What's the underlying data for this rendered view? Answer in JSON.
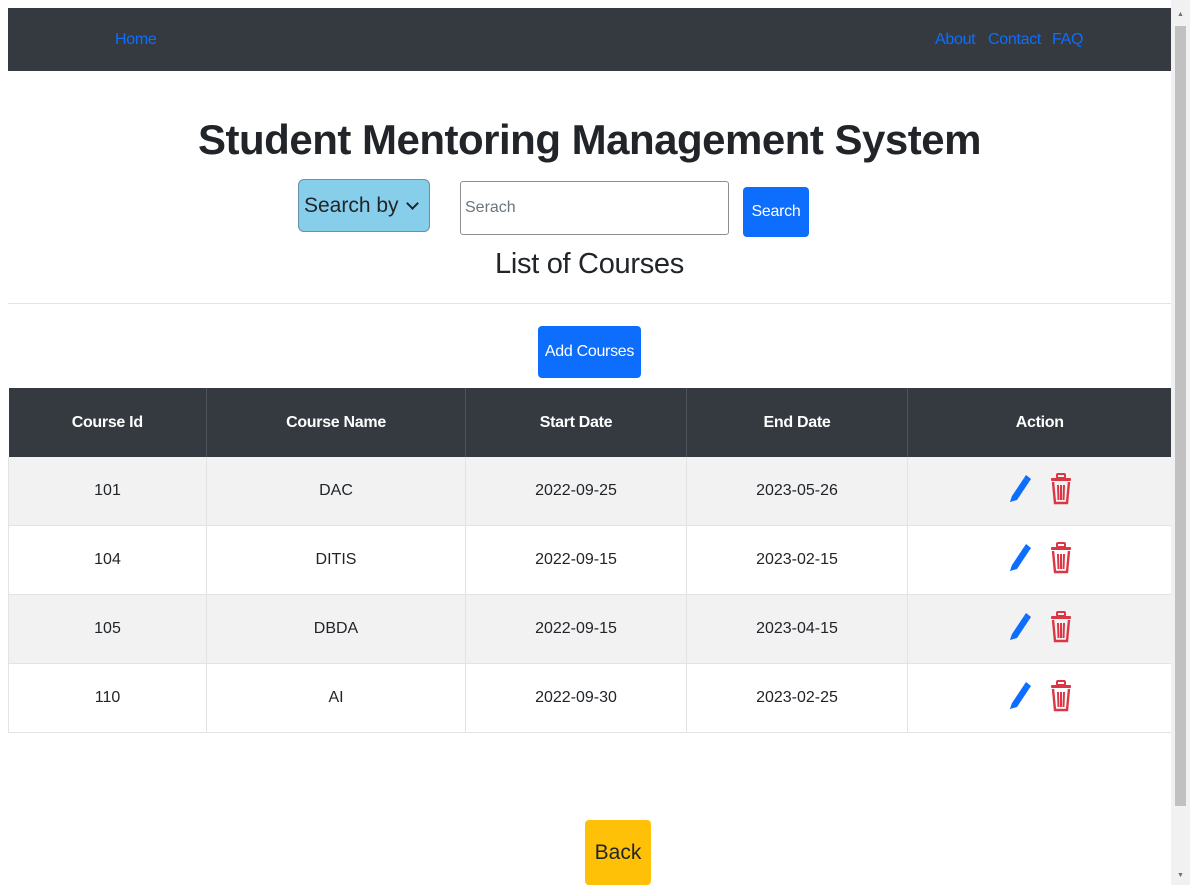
{
  "navbar": {
    "home": "Home",
    "about": "About",
    "contact": "Contact",
    "faq": "FAQ",
    "link_color": "#0d6efd",
    "background": "#343a40"
  },
  "header": {
    "title": "Student Mentoring Management System",
    "subtitle": "List of Courses"
  },
  "search": {
    "select_value": "Search by",
    "input_value": "",
    "input_placeholder": "Serach",
    "button_label": "Search"
  },
  "add_button_label": "Add Courses",
  "table": {
    "columns": [
      "Course Id",
      "Course Name",
      "Start Date",
      "End Date",
      "Action"
    ],
    "rows": [
      {
        "id": "101",
        "name": "DAC",
        "start": "2022-09-25",
        "end": "2023-05-26"
      },
      {
        "id": "104",
        "name": "DITIS",
        "start": "2022-09-15",
        "end": "2023-02-15"
      },
      {
        "id": "105",
        "name": "DBDA",
        "start": "2022-09-15",
        "end": "2023-04-15"
      },
      {
        "id": "110",
        "name": "AI",
        "start": "2022-09-30",
        "end": "2023-02-25"
      }
    ],
    "row_actions": [
      {
        "icon": "pencil-icon",
        "color": "#0d6efd"
      },
      {
        "icon": "trash-icon",
        "color": "#dc3545"
      }
    ]
  },
  "back_button_label": "Back",
  "colors": {
    "primary": "#0d6efd",
    "danger": "#dc3545",
    "warning": "#ffc107",
    "select_bg": "#87ceeb",
    "table_header": "#343a40"
  }
}
